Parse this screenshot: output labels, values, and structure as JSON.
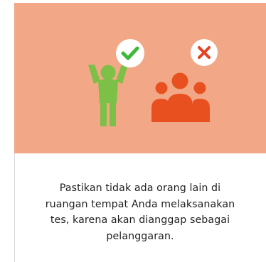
{
  "colors": {
    "banner_background": "#f2a887",
    "person_allowed": "#7cc047",
    "person_forbidden": "#e8511f",
    "badge_background": "#ffffff",
    "check_color": "#3fb83a",
    "cross_color": "#e8411f",
    "text_color": "#1f1f1f"
  },
  "icons": {
    "allowed_badge": "check-icon",
    "forbidden_badge": "close-icon",
    "single_person": "person-arms-up-icon",
    "group": "group-of-people-icon"
  },
  "instruction": {
    "lines": [
      "Pastikan tidak ada orang lain di",
      "ruangan tempat Anda melaksanakan",
      "tes, karena akan dianggap sebagai",
      "pelanggaran."
    ]
  }
}
